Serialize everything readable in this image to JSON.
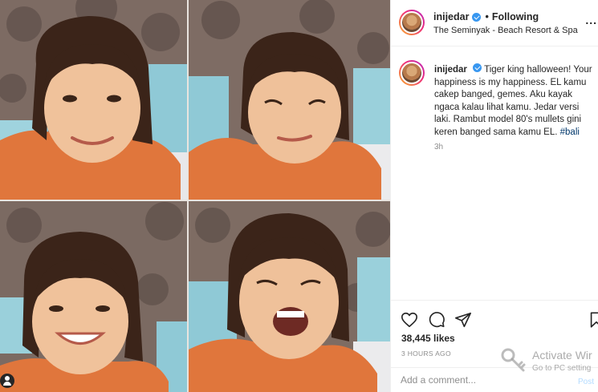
{
  "post": {
    "username": "inijedar",
    "follow_separator": "•",
    "follow_status": "Following",
    "location": "The Seminyak - Beach Resort & Spa",
    "more_label": "...",
    "caption_user": "inijedar",
    "caption_text": "Tiger king halloween! Your happiness is my happiness. EL kamu cakep banged, gemes. Aku kayak ngaca kalau lihat kamu. Jedar versi laki. Rambut model 80's mullets gini keren banged sama kamu EL.",
    "caption_hashtag": "#bali",
    "caption_time": "3h",
    "likes": "38,445 likes",
    "timestamp": "3 HOURS AGO",
    "comment_placeholder": "Add a comment...",
    "post_button": "Post"
  },
  "icons": {
    "verified": "verified-badge-icon",
    "like": "heart-icon",
    "comment": "comment-bubble-icon",
    "share": "paper-plane-icon",
    "save": "bookmark-icon",
    "tagged": "user-tag-icon"
  },
  "collage": {
    "tiles": [
      "smiling-child-photo",
      "squinting-child-photo",
      "grinning-child-photo",
      "laughing-child-photo"
    ]
  },
  "watermark": {
    "title": "Activate Wir",
    "subtitle": "Go to PC setting"
  },
  "colors": {
    "link": "#00376b",
    "verified": "#3897f0",
    "muted": "#8e8e8e",
    "text": "#262626"
  }
}
